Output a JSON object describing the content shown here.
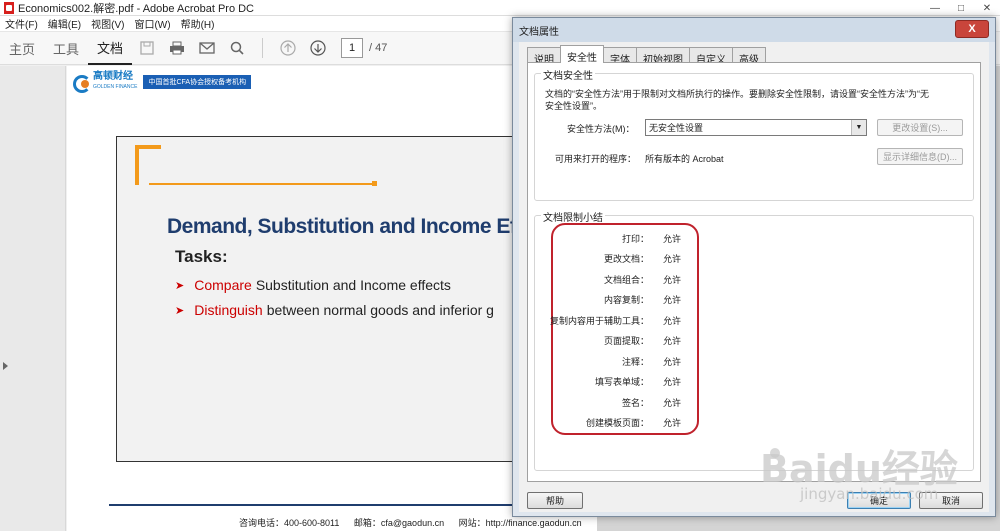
{
  "window": {
    "title": "Economics002.解密.pdf - Adobe Acrobat Pro DC"
  },
  "menu": [
    "文件(F)",
    "编辑(E)",
    "视图(V)",
    "窗口(W)",
    "帮助(H)"
  ],
  "toolbar": {
    "tabs": [
      "主页",
      "工具",
      "文档"
    ],
    "page_current": "1",
    "page_total": "/ 47"
  },
  "page": {
    "logo_name": "高顿财经",
    "logo_sub": "GOLDEN FINANCE",
    "logo_tag": "中国首批CFA协会授权备考机构",
    "slide_title": "Demand, Substitution and Income Effe",
    "tasks_label": "Tasks:",
    "bullets": [
      {
        "highlight": "Compare",
        "text": "Substitution and Income effects"
      },
      {
        "highlight": "Distinguish",
        "text": "between normal goods and inferior g"
      }
    ],
    "footer": {
      "phone": "咨询电话：400-600-8011",
      "email": "邮箱：cfa@gaodun.cn",
      "site": "网站：http://finance.gaodun.cn"
    }
  },
  "dialog": {
    "title": "文档属性",
    "close_label": "X",
    "tabs": [
      "说明",
      "安全性",
      "字体",
      "初始视图",
      "自定义",
      "高级"
    ],
    "security_group_label": "文档安全性",
    "security_desc": "文档的“安全性方法”用于限制对文档所执行的操作。要删除安全性限制，请设置“安全性方法”为“无安全性设置”。",
    "security_method_label": "安全性方法(M)：",
    "security_method_value": "无安全性设置",
    "change_settings": "更改设置(S)...",
    "can_open_label": "可用来打开的程序：",
    "can_open_value": "所有版本的 Acrobat",
    "show_details": "显示详细信息(D)...",
    "restrictions_label": "文档限制小结",
    "restrictions": [
      {
        "k": "打印：",
        "v": "允许"
      },
      {
        "k": "更改文档：",
        "v": "允许"
      },
      {
        "k": "文档组合：",
        "v": "允许"
      },
      {
        "k": "内容复制：",
        "v": "允许"
      },
      {
        "k": "复制内容用于辅助工具：",
        "v": "允许"
      },
      {
        "k": "页面提取：",
        "v": "允许"
      },
      {
        "k": "注释：",
        "v": "允许"
      },
      {
        "k": "填写表单域：",
        "v": "允许"
      },
      {
        "k": "签名：",
        "v": "允许"
      },
      {
        "k": "创建模板页面：",
        "v": "允许"
      }
    ],
    "help_button": "帮助",
    "ok_button": "确定",
    "cancel_button": "取消"
  },
  "watermark": {
    "main": "Baidu经验",
    "sub": "jingyan.baidu.com"
  }
}
